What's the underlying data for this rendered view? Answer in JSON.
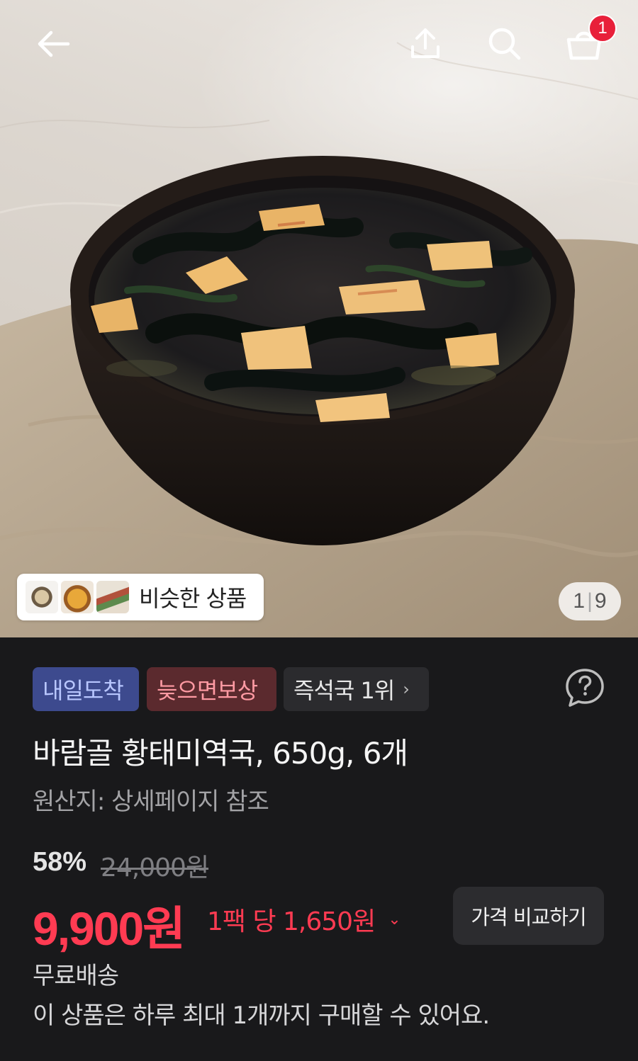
{
  "header": {
    "back_icon": "arrow-left-icon",
    "share_icon": "share-upload-icon",
    "search_icon": "search-icon",
    "cart_icon": "shopping-bag-icon",
    "cart_count": "1"
  },
  "gallery": {
    "image_subject": "seaweed soup in black bowl",
    "similar_label": "비슷한 상품",
    "current_page": "1",
    "total_pages": "9"
  },
  "badges": {
    "tomorrow": "내일도착",
    "late_compensation": "늦으면보상",
    "rank": "즉석국 1위",
    "rank_chevron": "›"
  },
  "help_icon": "question-bubble-icon",
  "product": {
    "title": "바람골 황태미역국, 650g, 6개",
    "origin": "원산지: 상세페이지 참조"
  },
  "pricing": {
    "discount": "58%",
    "original_price": "24,000원",
    "sale_price": "9,900원",
    "unit_price": "1팩 당 1,650원",
    "unit_dropdown": "⌄",
    "compare_button": "가격 비교하기"
  },
  "shipping": {
    "label": "무료배송",
    "purchase_limit": "이 상품은 하루 최대 1개까지 구매할 수 있어요."
  },
  "colors": {
    "background": "#19191b",
    "price_red": "#ff3b52",
    "badge_blue_bg": "#3d4a8e",
    "badge_red_bg": "#5b2a2e",
    "cart_badge": "#e8203a"
  }
}
